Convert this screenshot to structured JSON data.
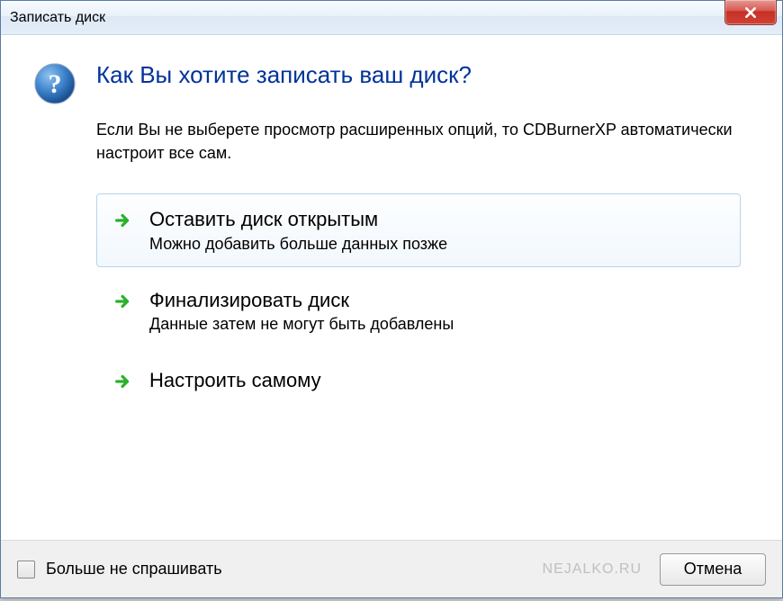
{
  "window": {
    "title": "Записать диск"
  },
  "dialog": {
    "heading": "Как Вы хотите записать ваш диск?",
    "description": "Если Вы не выберете просмотр расширенных опций, то CDBurnerXP автоматически настроит все сам."
  },
  "options": [
    {
      "title": "Оставить диск открытым",
      "desc": "Можно добавить больше данных позже",
      "selected": true
    },
    {
      "title": "Финализировать диск",
      "desc": "Данные затем не могут быть добавлены",
      "selected": false
    },
    {
      "title": "Настроить самому",
      "desc": "",
      "selected": false
    }
  ],
  "footer": {
    "checkbox_label": "Больше не спрашивать",
    "cancel_label": "Отмена",
    "watermark": "NEJALKO.RU"
  }
}
